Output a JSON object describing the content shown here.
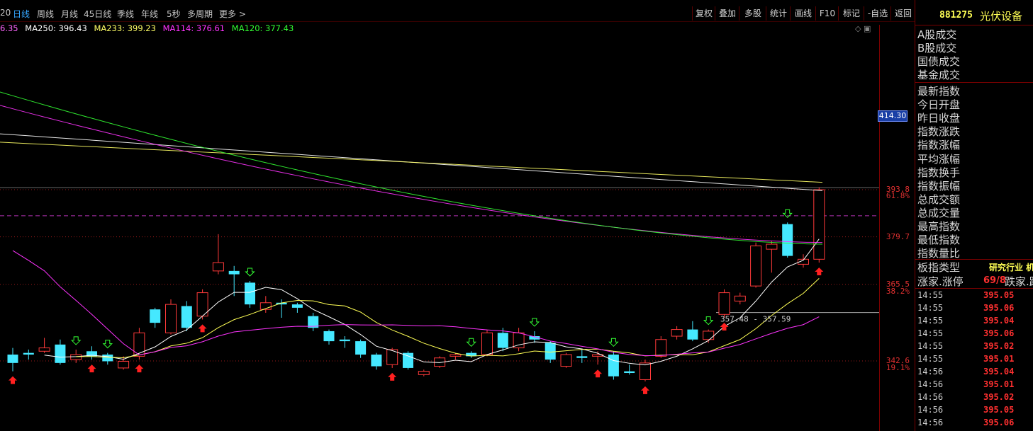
{
  "periods": [
    "20",
    "日线",
    "周线",
    "月线",
    "45日线",
    "季线",
    "年线",
    "5秒",
    "多周期",
    "更多 >"
  ],
  "active_period": "日线",
  "toolbar": [
    "复权",
    "叠加",
    "多股",
    "统计",
    "画线",
    "F10",
    "标记",
    "-自选",
    "返回"
  ],
  "ma_values": {
    "ma_first_tail": "6.35",
    "ma250": "MA250: 396.43",
    "ma233": "MA233: 399.23",
    "ma114": "MA114: 376.61",
    "ma120": "MA120: 377.43"
  },
  "ma_colors": {
    "ma250": "#ffffff",
    "ma233": "#ffff66",
    "ma114": "#ff33ff",
    "ma120": "#33ff33",
    "first": "#ff66ff"
  },
  "axis_labels": [
    {
      "text": "393.8",
      "price": 393.8
    },
    {
      "text": "61.8%",
      "price": 391.8
    },
    {
      "text": "379.7",
      "price": 379.7
    },
    {
      "text": "365.5",
      "price": 365.5
    },
    {
      "text": "38.2%",
      "price": 363.3
    },
    {
      "text": "342.6",
      "price": 342.6
    },
    {
      "text": "19.1%",
      "price": 340.4
    }
  ],
  "current_price_tag": "414.30",
  "range_annotation": "357.48 - 357.59",
  "symbol": {
    "code": "881275",
    "name": "光伏设备"
  },
  "right_labels_top": [
    "A股成交",
    "B股成交",
    "国债成交",
    "基金成交"
  ],
  "right_labels_mid": [
    "最新指数",
    "今日开盘",
    "昨日收盘",
    "指数涨跌",
    "指数涨幅",
    "平均涨幅",
    "指数换手",
    "指数振幅",
    "总成交额",
    "总成交量",
    "最高指数",
    "最低指数",
    "指数量比"
  ],
  "plate": {
    "label": "板指类型",
    "value": "研究行业 机"
  },
  "limit": {
    "label": "涨家.涨停",
    "value": "69/8",
    "label2": "跌家.跌"
  },
  "ticks": [
    {
      "time": "14:55",
      "price": "395.05"
    },
    {
      "time": "14:55",
      "price": "395.06"
    },
    {
      "time": "14:55",
      "price": "395.04"
    },
    {
      "time": "14:55",
      "price": "395.06"
    },
    {
      "time": "14:55",
      "price": "395.02"
    },
    {
      "time": "14:55",
      "price": "395.01"
    },
    {
      "time": "14:56",
      "price": "395.04"
    },
    {
      "time": "14:56",
      "price": "395.01"
    },
    {
      "time": "14:56",
      "price": "395.02"
    },
    {
      "time": "14:56",
      "price": "395.05"
    },
    {
      "time": "14:56",
      "price": "395.06"
    }
  ],
  "chart_data": {
    "type": "candlestick",
    "ylim": [
      330,
      430
    ],
    "fib_levels": [
      {
        "price": 393.8,
        "pct": "61.8%"
      },
      {
        "price": 379.7
      },
      {
        "price": 365.5,
        "pct": "38.2%"
      },
      {
        "price": 342.6,
        "pct": "19.1%"
      }
    ],
    "candles": [
      {
        "o": 344.5,
        "c": 342.0,
        "h": 346.5,
        "l": 339.5
      },
      {
        "o": 345.0,
        "c": 344.5,
        "h": 346.0,
        "l": 343.0
      },
      {
        "o": 345.5,
        "c": 346.5,
        "h": 349.5,
        "l": 345.0
      },
      {
        "o": 347.5,
        "c": 342.0,
        "h": 349.0,
        "l": 341.5
      },
      {
        "o": 343.0,
        "c": 344.5,
        "h": 346.0,
        "l": 342.0
      },
      {
        "o": 345.5,
        "c": 344.0,
        "h": 347.0,
        "l": 343.0
      },
      {
        "o": 344.5,
        "c": 342.5,
        "h": 345.0,
        "l": 341.5
      },
      {
        "o": 340.5,
        "c": 342.5,
        "h": 344.0,
        "l": 340.0
      },
      {
        "o": 344.0,
        "c": 351.0,
        "h": 352.5,
        "l": 343.0
      },
      {
        "o": 358.0,
        "c": 354.0,
        "h": 358.5,
        "l": 352.5
      },
      {
        "o": 351.0,
        "c": 359.5,
        "h": 361.0,
        "l": 350.5
      },
      {
        "o": 359.0,
        "c": 352.5,
        "h": 360.5,
        "l": 351.5
      },
      {
        "o": 356.0,
        "c": 363.0,
        "h": 364.0,
        "l": 355.0
      },
      {
        "o": 369.5,
        "c": 372.0,
        "h": 380.5,
        "l": 368.5
      },
      {
        "o": 369.5,
        "c": 368.5,
        "h": 371.0,
        "l": 362.0
      },
      {
        "o": 366.0,
        "c": 359.5,
        "h": 366.5,
        "l": 358.5
      },
      {
        "o": 358.0,
        "c": 360.0,
        "h": 362.0,
        "l": 357.0
      },
      {
        "o": 360.0,
        "c": 359.5,
        "h": 361.0,
        "l": 355.5
      },
      {
        "o": 359.5,
        "c": 358.5,
        "h": 360.0,
        "l": 357.0
      },
      {
        "o": 356.0,
        "c": 352.5,
        "h": 357.0,
        "l": 351.5
      },
      {
        "o": 351.5,
        "c": 348.5,
        "h": 352.0,
        "l": 347.5
      },
      {
        "o": 349.0,
        "c": 348.5,
        "h": 350.0,
        "l": 346.5
      },
      {
        "o": 348.5,
        "c": 344.5,
        "h": 349.0,
        "l": 343.5
      },
      {
        "o": 344.5,
        "c": 341.0,
        "h": 345.0,
        "l": 340.0
      },
      {
        "o": 341.5,
        "c": 346.0,
        "h": 346.5,
        "l": 340.5
      },
      {
        "o": 345.0,
        "c": 340.5,
        "h": 345.5,
        "l": 340.0
      },
      {
        "o": 338.5,
        "c": 339.5,
        "h": 340.0,
        "l": 338.0
      },
      {
        "o": 341.0,
        "c": 343.5,
        "h": 344.0,
        "l": 340.5
      },
      {
        "o": 344.0,
        "c": 344.5,
        "h": 345.0,
        "l": 343.0
      },
      {
        "o": 345.0,
        "c": 344.0,
        "h": 345.5,
        "l": 343.5
      },
      {
        "o": 344.5,
        "c": 351.0,
        "h": 352.0,
        "l": 344.0
      },
      {
        "o": 351.0,
        "c": 346.5,
        "h": 352.5,
        "l": 345.5
      },
      {
        "o": 346.5,
        "c": 351.0,
        "h": 352.5,
        "l": 345.5
      },
      {
        "o": 350.0,
        "c": 349.0,
        "h": 351.5,
        "l": 348.0
      },
      {
        "o": 348.0,
        "c": 343.0,
        "h": 348.5,
        "l": 342.0
      },
      {
        "o": 341.0,
        "c": 344.5,
        "h": 345.0,
        "l": 340.5
      },
      {
        "o": 344.0,
        "c": 343.5,
        "h": 346.0,
        "l": 342.0
      },
      {
        "o": 344.0,
        "c": 344.5,
        "h": 345.5,
        "l": 341.5
      },
      {
        "o": 344.5,
        "c": 338.0,
        "h": 345.5,
        "l": 337.0
      },
      {
        "o": 339.5,
        "c": 339.0,
        "h": 341.5,
        "l": 338.5
      },
      {
        "o": 337.0,
        "c": 342.0,
        "h": 343.0,
        "l": 336.5
      },
      {
        "o": 344.0,
        "c": 349.0,
        "h": 350.0,
        "l": 343.5
      },
      {
        "o": 350.0,
        "c": 352.0,
        "h": 353.0,
        "l": 349.0
      },
      {
        "o": 352.0,
        "c": 349.0,
        "h": 354.5,
        "l": 348.5
      },
      {
        "o": 349.0,
        "c": 351.5,
        "h": 352.0,
        "l": 348.0
      },
      {
        "o": 356.5,
        "c": 363.0,
        "h": 364.0,
        "l": 355.5
      },
      {
        "o": 360.5,
        "c": 362.0,
        "h": 363.0,
        "l": 359.5
      },
      {
        "o": 365.0,
        "c": 377.0,
        "h": 378.0,
        "l": 364.5
      },
      {
        "o": 376.0,
        "c": 377.5,
        "h": 378.5,
        "l": 369.0
      },
      {
        "o": 383.5,
        "c": 374.0,
        "h": 384.0,
        "l": 373.5
      },
      {
        "o": 371.5,
        "c": 373.0,
        "h": 374.5,
        "l": 370.5
      },
      {
        "o": 373.0,
        "c": 393.8,
        "h": 394.5,
        "l": 372.0
      }
    ],
    "ma_lines": [
      {
        "name": "MA250",
        "color": "#ffffff",
        "start": 410.5,
        "end": 393.5
      },
      {
        "name": "MA233",
        "color": "#ffff66",
        "start": 408.0,
        "end": 396.0
      },
      {
        "name": "MA114",
        "color": "#ff33ff",
        "start": 419.0,
        "end": 378.0
      },
      {
        "name": "MA120",
        "color": "#33ff33",
        "start": 423.0,
        "end": 377.5
      }
    ]
  }
}
